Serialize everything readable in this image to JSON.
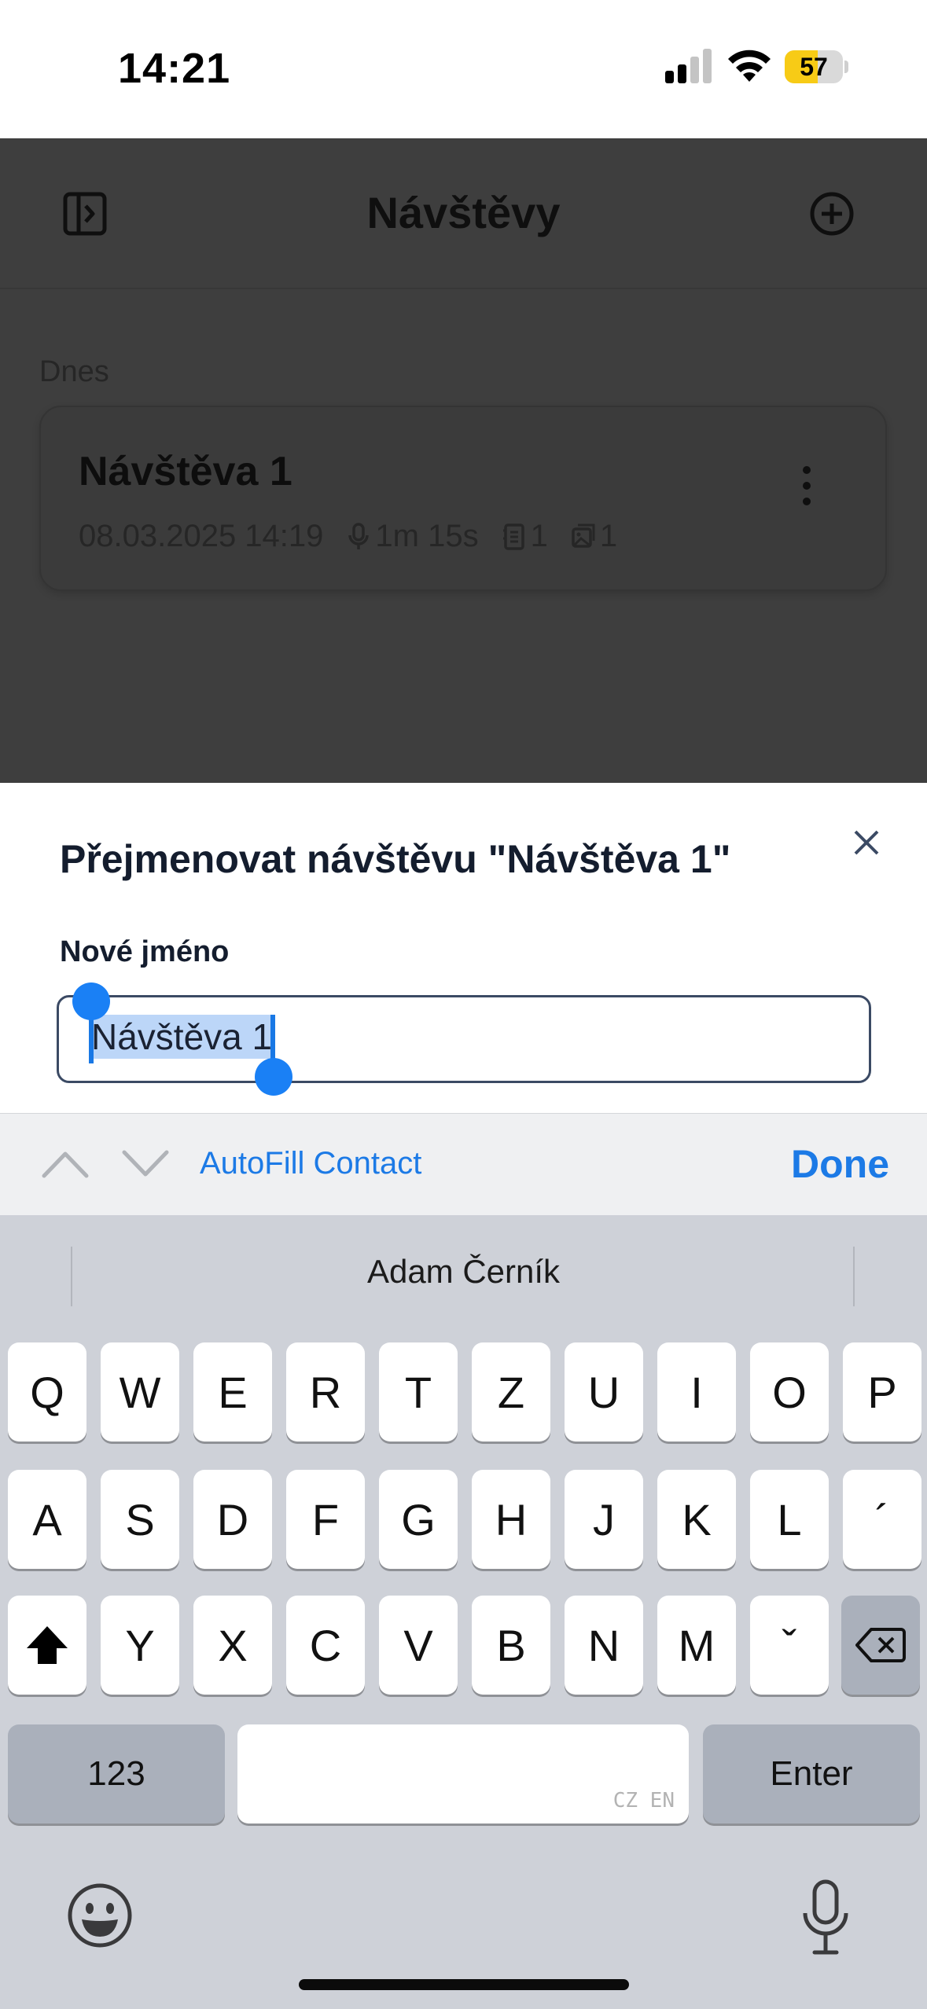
{
  "status_bar": {
    "time": "14:21",
    "battery": 57
  },
  "header": {
    "title": "Návštěvy"
  },
  "list": {
    "section": "Dnes",
    "items": [
      {
        "title": "Návštěva 1",
        "datetime": "08.03.2025 14:19",
        "duration": "1m 15s",
        "notes": "1",
        "images": "1"
      }
    ]
  },
  "dialog": {
    "title": "Přejmenovat návštěvu \"Návštěva 1\"",
    "field_label": "Nové jméno",
    "field_value": "Návštěva 1"
  },
  "accessory": {
    "autofill": "AutoFill Contact",
    "done": "Done"
  },
  "keyboard": {
    "suggestion": "Adam Černík",
    "row1": [
      "Q",
      "W",
      "E",
      "R",
      "T",
      "Z",
      "U",
      "I",
      "O",
      "P"
    ],
    "row2": [
      "A",
      "S",
      "D",
      "F",
      "G",
      "H",
      "J",
      "K",
      "L",
      "´"
    ],
    "row3": [
      "Y",
      "X",
      "C",
      "V",
      "B",
      "N",
      "M",
      "ˇ"
    ],
    "numbers": "123",
    "languages": "CZ EN",
    "enter": "Enter"
  },
  "colors": {
    "accent": "#1c7ae6",
    "selection": "#bcd6f8",
    "battery": "#f7cb16",
    "overlay": "#3e3e3e"
  }
}
